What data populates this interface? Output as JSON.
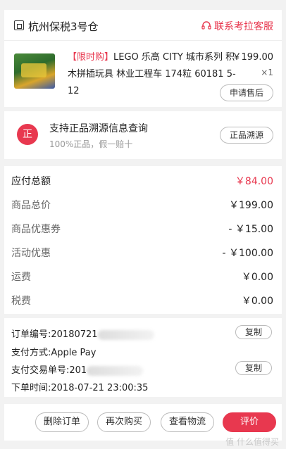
{
  "header": {
    "warehouse": "杭州保税3号仓",
    "service_label": "联系考拉客服"
  },
  "product": {
    "tag": "【限时购】",
    "title": "LEGO 乐高 CITY 城市系列 积木拼插玩具 林业工程车 174粒 60181 5-12",
    "price": "￥199.00",
    "qty": "×1",
    "after_sale_label": "申请售后"
  },
  "trace": {
    "icon_char": "正",
    "title": "支持正品溯源信息查询",
    "subtitle": "100%正品，假一赔十",
    "button": "正品溯源"
  },
  "price": {
    "rows": [
      {
        "label": "应付总额",
        "value": "￥84.00"
      },
      {
        "label": "商品总价",
        "value": "￥199.00"
      },
      {
        "label": "商品优惠券",
        "value": "- ￥15.00"
      },
      {
        "label": "活动优惠",
        "value": "- ￥100.00"
      },
      {
        "label": "运费",
        "value": "￥0.00"
      },
      {
        "label": "税费",
        "value": "￥0.00"
      }
    ]
  },
  "order": {
    "number_label": "订单编号:",
    "number_value": "20180721",
    "pay_method": "支付方式:Apple Pay",
    "txn_label": "支付交易单号:",
    "txn_value": "201",
    "time": "下单时间:2018-07-21 23:00:35",
    "copy_label": "复制"
  },
  "footer": {
    "delete": "删除订单",
    "rebuy": "再次购买",
    "logistics": "查看物流",
    "review": "评价"
  },
  "watermark": "值 什么值得买"
}
